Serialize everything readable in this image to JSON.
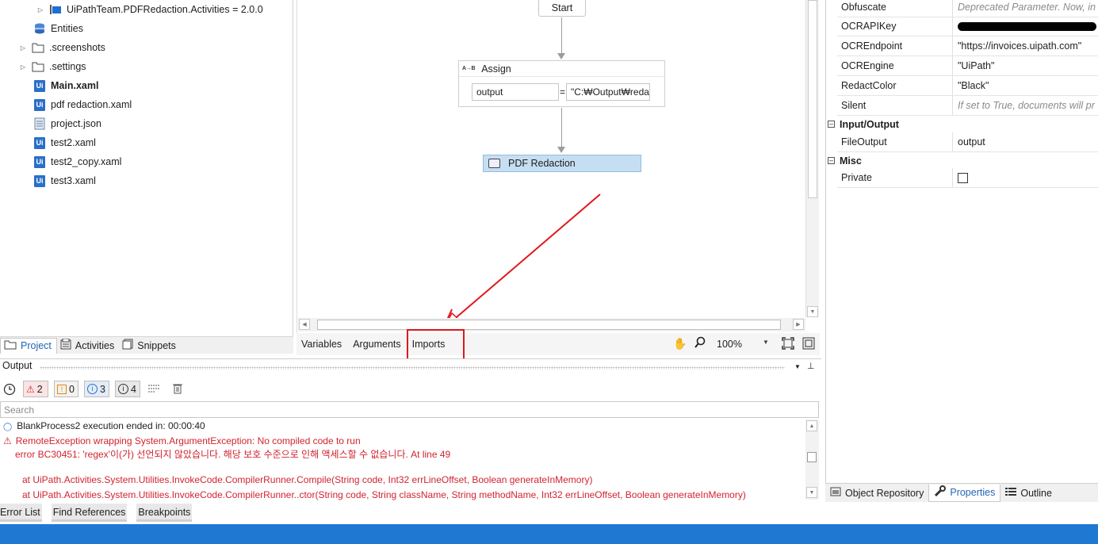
{
  "project_tree": {
    "items": [
      {
        "label": "UiPathTeam.PDFRedaction.Activities = 2.0.0",
        "icon": "package-icon",
        "bold": false
      },
      {
        "label": "Entities",
        "icon": "database-icon",
        "bold": false
      },
      {
        "label": ".screenshots",
        "icon": "folder-icon",
        "bold": false
      },
      {
        "label": ".settings",
        "icon": "folder-icon",
        "bold": false
      },
      {
        "label": "Main.xaml",
        "icon": "xaml-icon",
        "bold": true
      },
      {
        "label": "pdf redaction.xaml",
        "icon": "xaml-icon",
        "bold": false
      },
      {
        "label": "project.json",
        "icon": "json-file-icon",
        "bold": false
      },
      {
        "label": "test2.xaml",
        "icon": "xaml-icon",
        "bold": false
      },
      {
        "label": "test2_copy.xaml",
        "icon": "xaml-icon",
        "bold": false
      },
      {
        "label": "test3.xaml",
        "icon": "xaml-icon",
        "bold": false
      }
    ]
  },
  "left_tabs": {
    "project": "Project",
    "activities": "Activities",
    "snippets": "Snippets"
  },
  "designer": {
    "start_label": "Start",
    "assign": {
      "title": "Assign",
      "icon_text": "A→B",
      "to": "output",
      "equals": "=",
      "value": "\"C:₩Output₩redac"
    },
    "pdf_activity": "PDF Redaction",
    "tabs": {
      "variables": "Variables",
      "arguments": "Arguments",
      "imports": "Imports"
    },
    "zoom": "100%"
  },
  "properties": {
    "rows_top": [
      {
        "name": "Obfuscate",
        "value": "Deprecated Parameter.  Now, in",
        "hint": true
      },
      {
        "name": "OCRAPIKey",
        "value": "",
        "redacted": true
      },
      {
        "name": "OCREndpoint",
        "value": "\"https://invoices.uipath.com\"",
        "hint": false
      },
      {
        "name": "OCREngine",
        "value": "\"UiPath\"",
        "hint": false
      },
      {
        "name": "RedactColor",
        "value": "\"Black\"",
        "hint": false
      },
      {
        "name": "Silent",
        "value": "If set to True, documents will pr",
        "hint": true
      }
    ],
    "category_io": "Input/Output",
    "file_output": {
      "name": "FileOutput",
      "value": "output"
    },
    "category_misc": "Misc",
    "private": {
      "name": "Private"
    },
    "tabs": {
      "object_repository": "Object Repository",
      "properties": "Properties",
      "outline": "Outline"
    }
  },
  "output": {
    "title": "Output",
    "filters": {
      "errors": "2",
      "warnings": "0",
      "info": "3",
      "trace": "4"
    },
    "search_placeholder": "Search",
    "lines": [
      {
        "type": "info",
        "text": "BlankProcess2 execution ended in: 00:00:40"
      },
      {
        "type": "error",
        "text": "RemoteException wrapping System.ArgumentException: No compiled code to run"
      },
      {
        "type": "error",
        "text": "error BC30451: 'regex'이(가) 선언되지 않았습니다. 해당 보호 수준으로 인해 액세스할 수 없습니다. At line 49"
      },
      {
        "type": "error",
        "text": "at UiPath.Activities.System.Utilities.InvokeCode.CompilerRunner.Compile(String code, Int32 errLineOffset, Boolean generateInMemory)"
      },
      {
        "type": "error",
        "text": "at UiPath.Activities.System.Utilities.InvokeCode.CompilerRunner..ctor(String code, String className, String methodName, Int32 errLineOffset, Boolean generateInMemory)"
      }
    ]
  },
  "bottom_tabs": {
    "error_list": "Error List",
    "find_references": "Find References",
    "breakpoints": "Breakpoints"
  },
  "colors": {
    "status_bar": "#1f78d1",
    "annotation": "#e0181b",
    "selected_activity": "#c6def2"
  }
}
